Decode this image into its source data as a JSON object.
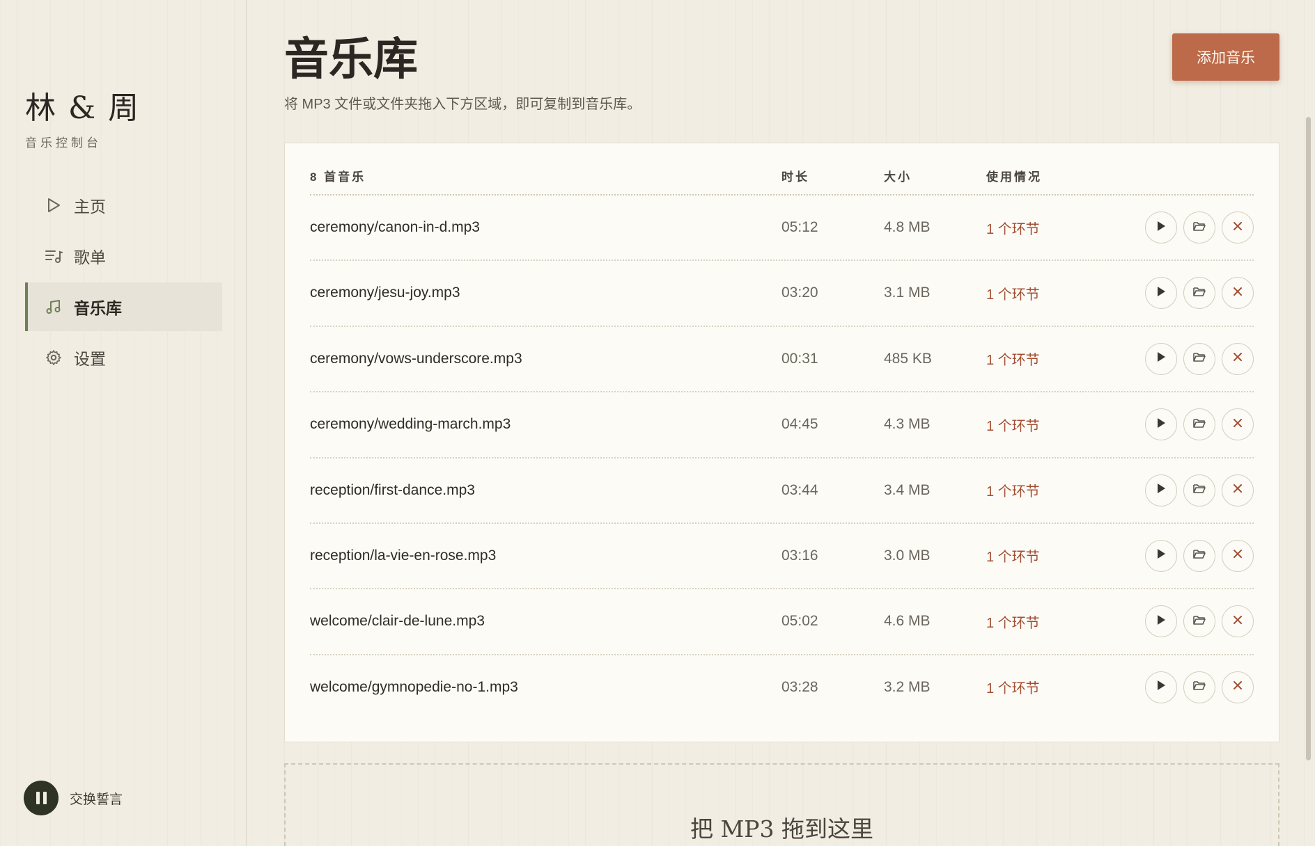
{
  "brand": {
    "title": "林 & 周",
    "subtitle": "音乐控制台"
  },
  "nav": {
    "items": [
      {
        "label": "主页",
        "icon": "play-outline-icon"
      },
      {
        "label": "歌单",
        "icon": "playlist-icon"
      },
      {
        "label": "音乐库",
        "icon": "music-note-icon",
        "active": true
      },
      {
        "label": "设置",
        "icon": "gear-icon"
      }
    ]
  },
  "player": {
    "now_playing": "交换誓言",
    "state": "playing",
    "control_icon": "pause-icon"
  },
  "page": {
    "title": "音乐库",
    "subtitle": "将 MP3 文件或文件夹拖入下方区域，即可复制到音乐库。",
    "add_button": "添加音乐"
  },
  "table": {
    "headers": {
      "name": "8 首音乐",
      "duration": "时长",
      "size": "大小",
      "usage": "使用情况"
    },
    "rows": [
      {
        "name": "ceremony/canon-in-d.mp3",
        "duration": "05:12",
        "size": "4.8 MB",
        "usage": "1 个环节"
      },
      {
        "name": "ceremony/jesu-joy.mp3",
        "duration": "03:20",
        "size": "3.1 MB",
        "usage": "1 个环节"
      },
      {
        "name": "ceremony/vows-underscore.mp3",
        "duration": "00:31",
        "size": "485 KB",
        "usage": "1 个环节"
      },
      {
        "name": "ceremony/wedding-march.mp3",
        "duration": "04:45",
        "size": "4.3 MB",
        "usage": "1 个环节"
      },
      {
        "name": "reception/first-dance.mp3",
        "duration": "03:44",
        "size": "3.4 MB",
        "usage": "1 个环节"
      },
      {
        "name": "reception/la-vie-en-rose.mp3",
        "duration": "03:16",
        "size": "3.0 MB",
        "usage": "1 个环节"
      },
      {
        "name": "welcome/clair-de-lune.mp3",
        "duration": "05:02",
        "size": "4.6 MB",
        "usage": "1 个环节"
      },
      {
        "name": "welcome/gymnopedie-no-1.mp3",
        "duration": "03:28",
        "size": "3.2 MB",
        "usage": "1 个环节"
      }
    ],
    "row_actions": [
      "play-icon",
      "folder-icon",
      "close-icon"
    ]
  },
  "dropzone": {
    "label": "把 MP3 拖到这里"
  },
  "colors": {
    "accent": "#bc6a49",
    "active_marker": "#6f8058",
    "usage_text": "#a24e33",
    "background": "#f1ede3"
  }
}
